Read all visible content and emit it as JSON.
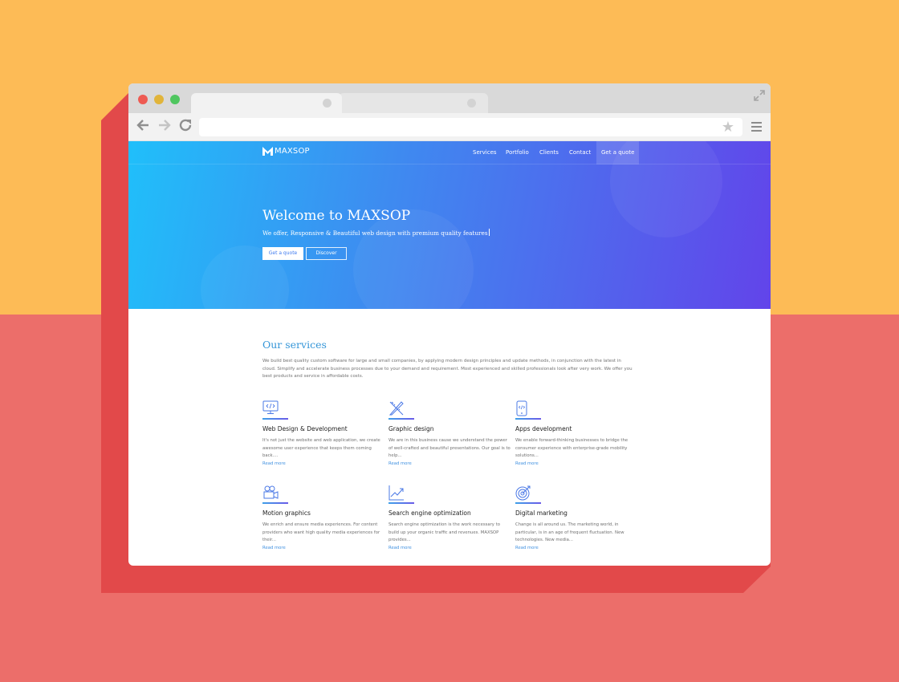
{
  "browser": {
    "address_bar": {
      "value": ""
    }
  },
  "site": {
    "logo": {
      "text": "MAXSOP"
    },
    "nav": [
      "Services",
      "Portfolio",
      "Clients",
      "Contact",
      "Get a quote"
    ],
    "hero": {
      "title": "Welcome to MAXSOP",
      "subtitle": "We offer, Responsive & Beautiful web design with premium quality features",
      "buttons": {
        "quote": "Get a quote",
        "discover": "Discover"
      }
    },
    "services": {
      "title": "Our services",
      "description": "We build best quality custom software for large and small companies, by applying modern design principles and update methods, in conjunction with the latest in cloud. Simplify and accelerate business processes due to your demand and requirement. Most experienced and skilled professionals look after very work. We offer you best products and service in affordable costs.",
      "items": [
        {
          "icon": "monitor-code-icon",
          "title": "Web Design & Development",
          "desc": "It's not just the website and web application, we create awesome user experience that keeps them coming back....",
          "link": "Read more"
        },
        {
          "icon": "pencil-ruler-icon",
          "title": "Graphic design",
          "desc": "We are in this business cause we understand the power of well-crafted and beautiful presentations. Our goal is to help...",
          "link": "Read more"
        },
        {
          "icon": "mobile-code-icon",
          "title": "Apps development",
          "desc": "We enable forward-thinking businesses to bridge the consumer experience with enterprise-grade mobility solutions...",
          "link": "Read more"
        },
        {
          "icon": "video-camera-icon",
          "title": "Motion graphics",
          "desc": "We enrich and ensure media experiences. For content providers who want high quality media experiences for their...",
          "link": "Read more"
        },
        {
          "icon": "chart-line-icon",
          "title": "Search engine optimization",
          "desc": "Search engine optimization is the work necessary to build up your organic traffic and revenues. MAXSOP provides...",
          "link": "Read more"
        },
        {
          "icon": "target-icon",
          "title": "Digital marketing",
          "desc": "Change is all around us. The marketing world, in particular, is in an age of frequent fluctuation. New technologies. New media...",
          "link": "Read more"
        }
      ]
    }
  },
  "colors": {
    "background_top": "#FDBB56",
    "background_bottom": "#EC6E6A",
    "hero_gradient_start": "#20BFFA",
    "hero_gradient_end": "#6244EA",
    "accent": "#3596D8",
    "link": "#3D8FE0"
  }
}
